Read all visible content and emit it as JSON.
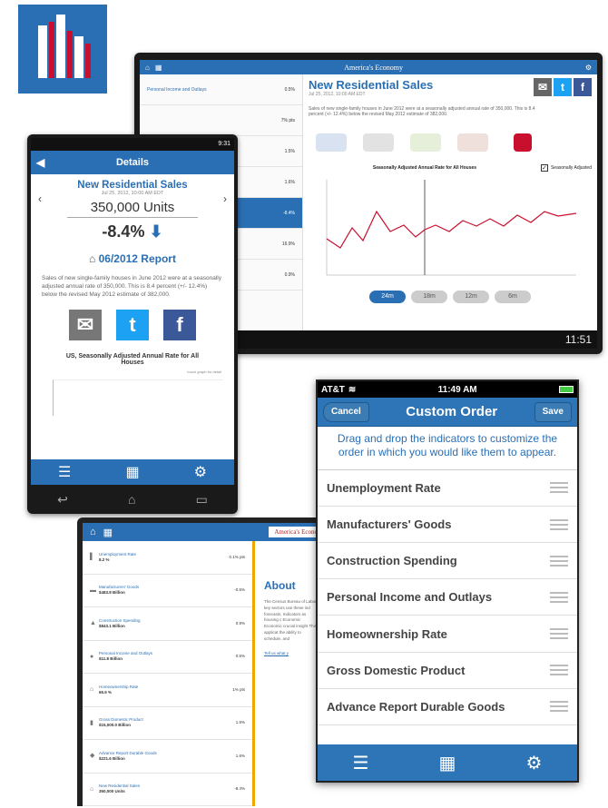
{
  "tablet1": {
    "brand": "America's Economy",
    "title": "New Residential Sales",
    "date": "Jul 25, 2012, 10:00 AM EDT",
    "description": "Sales of new single-family houses in June 2012 were at a seasonally adjusted annual rate of 350,000. This is 8.4 percent (+/- 12.4%) below the revised May 2012 estimate of 382,000.",
    "rows": [
      {
        "label": "Personal Income and Outlays",
        "value": "0.5%"
      },
      {
        "label": "",
        "value": "7% pts"
      },
      {
        "label": "",
        "value": "1.5%"
      },
      {
        "label": "",
        "value": "1.6%"
      },
      {
        "label": "",
        "value": "-8.4%"
      },
      {
        "label": "",
        "value": "16.9%"
      },
      {
        "label": "",
        "value": "0.9%"
      }
    ],
    "chart_title": "Seasonally Adjusted Annual Rate for All Houses",
    "seasonally_adjusted": "Seasonally Adjusted",
    "ranges": [
      "24m",
      "18m",
      "12m",
      "6m"
    ],
    "clock": "11:51"
  },
  "phone": {
    "header": "Details",
    "clock": "9:31",
    "title": "New Residential Sales",
    "date": "Jul 25, 2012, 10:00 AM EDT",
    "units": "350,000 Units",
    "percent": "-8.4%",
    "report": "06/2012 Report",
    "description": "Sales of new single-family houses in June 2012 were at a seasonally adjusted annual rate of 350,000. This is 8.4 percent (+/- 12.4%) below the revised May 2012 estimate of 382,000.",
    "chart_title": "US, Seasonally Adjusted Annual Rate for All Houses",
    "touch_hint": "touch graph for detail"
  },
  "tablet2": {
    "brand": "America's Economy",
    "about_title": "About",
    "about_text": "The Census Bureau of Labor key sectors use these ind forecasts, Indicators as housing c Economic Economic crucial insight This applicat the ability to schedule, and",
    "link": "Tell us what y",
    "rows": [
      {
        "label": "Unemployment Rate",
        "sub": "8.2 %",
        "value": "0.1% pts"
      },
      {
        "label": "Manufacturers' Goods",
        "sub": "$483.8 Billion",
        "value": "-0.5%"
      },
      {
        "label": "Construction Spending",
        "sub": "$843.1 Billion",
        "value": "0.9%"
      },
      {
        "label": "Personal Income and Outlays",
        "sub": "$11.8 Billion",
        "value": "0.5%"
      },
      {
        "label": "Homeownership Rate",
        "sub": "65.5 %",
        "value": "1% pts"
      },
      {
        "label": "Gross Domestic Product",
        "sub": "$15,000.0 Billion",
        "value": "1.5%"
      },
      {
        "label": "Advance Report Durable Goods",
        "sub": "$221.6 Billion",
        "value": "1.6%"
      },
      {
        "label": "New Residential Sales",
        "sub": "350,000 Units",
        "value": "-8.4%"
      }
    ]
  },
  "iphone": {
    "carrier": "AT&T",
    "time": "11:49 AM",
    "title": "Custom Order",
    "cancel": "Cancel",
    "save": "Save",
    "instructions": "Drag and drop the indicators to customize the order in which you would like them to appear.",
    "items": [
      "Unemployment Rate",
      "Manufacturers' Goods",
      "Construction Spending",
      "Personal Income and Outlays",
      "Homeownership Rate",
      "Gross Domestic Product",
      "Advance Report Durable Goods"
    ]
  }
}
